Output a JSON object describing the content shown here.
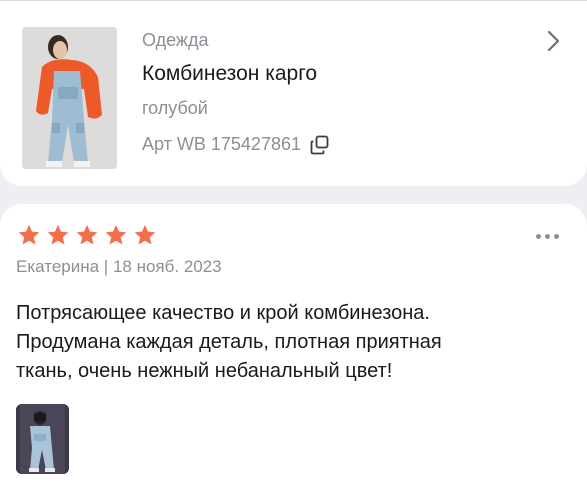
{
  "product": {
    "category": "Одежда",
    "title": "Комбинезон карго",
    "color": "голубой",
    "sku_prefix": "Арт WB",
    "sku": "175427861",
    "thumbnail": "product-photo-woman-in-light-blue-jumpsuit-orange-jacket"
  },
  "review": {
    "rating": 5,
    "rating_max": 5,
    "star_color": "#f36f4b",
    "author": "Екатерина",
    "date": "18 нояб. 2023",
    "text_lines": [
      "Потрясающее качество и крой комбинезона.",
      "Продумана каждая деталь, плотная приятная",
      "ткань, очень нежный небанальный цвет!"
    ],
    "photo": "review-photo-mirror-selfie-in-jumpsuit"
  },
  "icons": {
    "chevron": "chevron-right-icon",
    "copy": "copy-icon",
    "more": "more-dots-icon",
    "star": "star-icon"
  }
}
